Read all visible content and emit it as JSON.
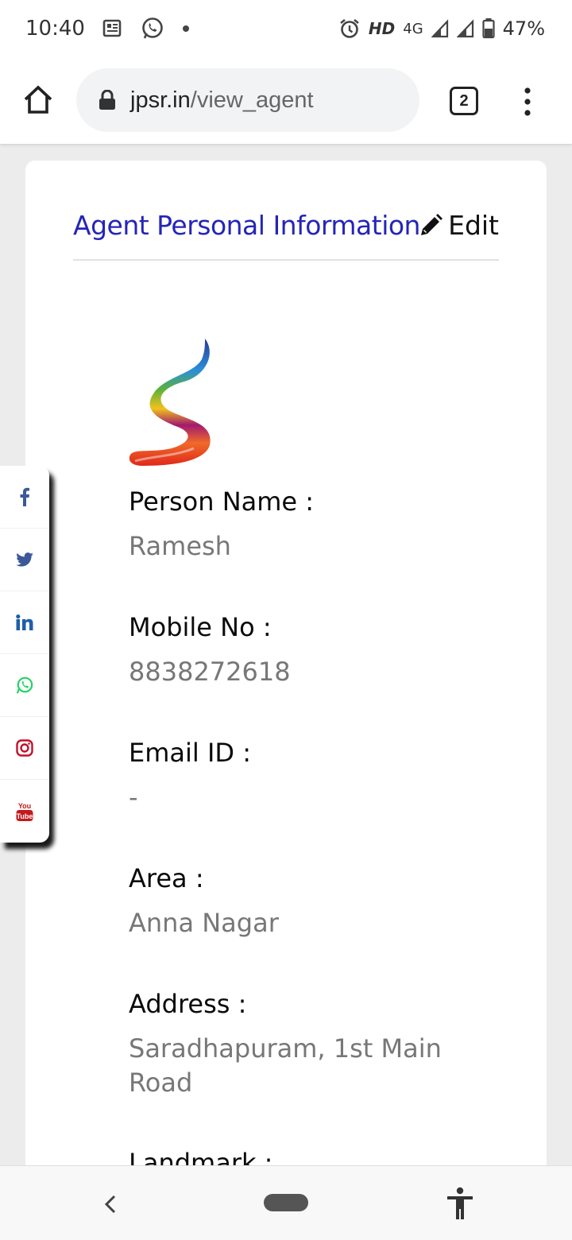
{
  "status_bar": {
    "time": "10:40",
    "hd": "HD",
    "network": "4G",
    "battery": "47%"
  },
  "browser": {
    "url_host": "jpsr.in",
    "url_path": "/view_agent",
    "tab_count": "2"
  },
  "card": {
    "title": "Agent Personal Information",
    "edit_label": "Edit",
    "fields": [
      {
        "label": "Person Name :",
        "value": "Ramesh"
      },
      {
        "label": "Mobile No :",
        "value": "8838272618"
      },
      {
        "label": "Email ID :",
        "value": "-"
      },
      {
        "label": "Area :",
        "value": "Anna Nagar"
      },
      {
        "label": "Address :",
        "value": "Saradhapuram, 1st Main Road"
      },
      {
        "label": "Landmark :",
        "value": ""
      }
    ]
  },
  "social": {
    "icons": [
      "facebook-icon",
      "twitter-icon",
      "linkedin-icon",
      "whatsapp-icon",
      "instagram-icon",
      "youtube-icon"
    ],
    "colors": {
      "facebook": "#3b5998",
      "twitter": "#3b5998",
      "linkedin": "#1f5fa8",
      "whatsapp": "#25d366",
      "instagram": "#c0122b",
      "youtube": "#c4181c"
    },
    "youtube_text_top": "You",
    "youtube_text_bottom": "Tube"
  },
  "colors": {
    "title": "#2425b8",
    "value": "#777777",
    "page_bg": "#ececec"
  }
}
